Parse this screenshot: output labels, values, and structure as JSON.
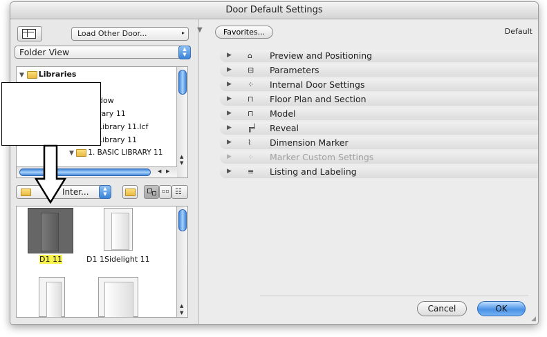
{
  "window": {
    "title": "Door Default Settings"
  },
  "left_panel": {
    "load_other_label": "Load Other Door...",
    "view_mode": "Folder View",
    "tree": [
      {
        "label": "Libraries",
        "bold": true
      },
      {
        "label": "dow"
      },
      {
        "label": "rary 11"
      },
      {
        "label": "Library 11.lcf"
      },
      {
        "label": "Library 11"
      },
      {
        "label": "1. BASIC LIBRARY 11"
      }
    ],
    "folder_popup": "Inter...",
    "items": [
      {
        "label": "D1 11",
        "selected": true
      },
      {
        "label": "D1 1Sidelight 11",
        "selected": false
      }
    ]
  },
  "right_panel": {
    "favorites_label": "Favorites...",
    "default_label": "Default",
    "sections": [
      {
        "label": "Preview and Positioning",
        "icon": "preview-icon",
        "enabled": true
      },
      {
        "label": "Parameters",
        "icon": "parameters-icon",
        "enabled": true
      },
      {
        "label": "Internal Door Settings",
        "icon": "internal-settings-icon",
        "enabled": true
      },
      {
        "label": "Floor Plan and Section",
        "icon": "floor-plan-icon",
        "enabled": true
      },
      {
        "label": "Model",
        "icon": "model-icon",
        "enabled": true
      },
      {
        "label": "Reveal",
        "icon": "reveal-icon",
        "enabled": true
      },
      {
        "label": "Dimension Marker",
        "icon": "dimension-marker-icon",
        "enabled": true
      },
      {
        "label": "Marker Custom Settings",
        "icon": "marker-custom-icon",
        "enabled": false
      },
      {
        "label": "Listing and Labeling",
        "icon": "listing-icon",
        "enabled": true
      }
    ],
    "cancel_label": "Cancel",
    "ok_label": "OK"
  }
}
